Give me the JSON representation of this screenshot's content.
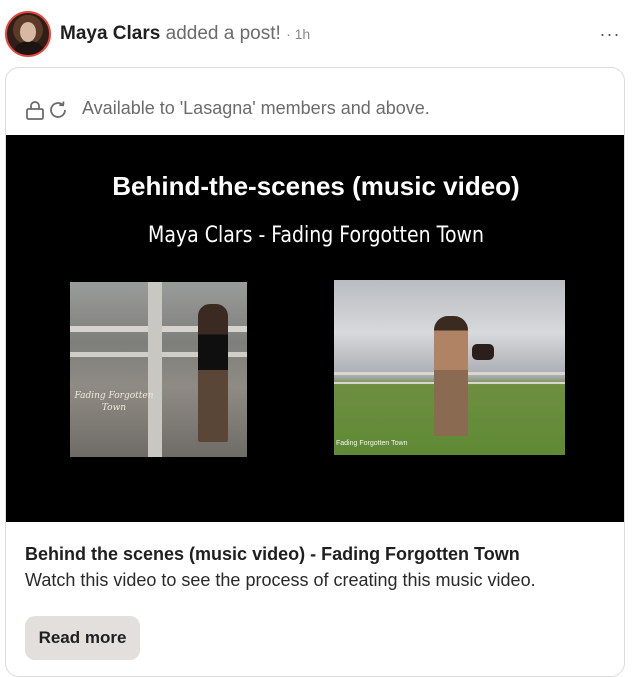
{
  "post": {
    "author_name": "Maya Clars",
    "action_text": "added a post!",
    "timestamp": "· 1h",
    "more_label": "···"
  },
  "access": {
    "text": "Available to 'Lasagna' members and above.",
    "icons": [
      "lock-icon",
      "refresh-icon"
    ]
  },
  "video": {
    "title": "Behind-the-scenes (music video)",
    "subtitle": "Maya Clars - Fading Forgotten Town",
    "left_thumb_caption": "Fading Forgotten Town",
    "right_thumb_caption": "Fading Forgotten Town"
  },
  "content": {
    "title": "Behind the scenes (music video) - Fading Forgotten Town",
    "description": "Watch this video to see the process of creating this music video."
  },
  "actions": {
    "read_more_label": "Read more"
  },
  "colors": {
    "avatar_ring": "#e8453c",
    "button_bg": "#e2dfdd",
    "video_bg": "#000000"
  }
}
